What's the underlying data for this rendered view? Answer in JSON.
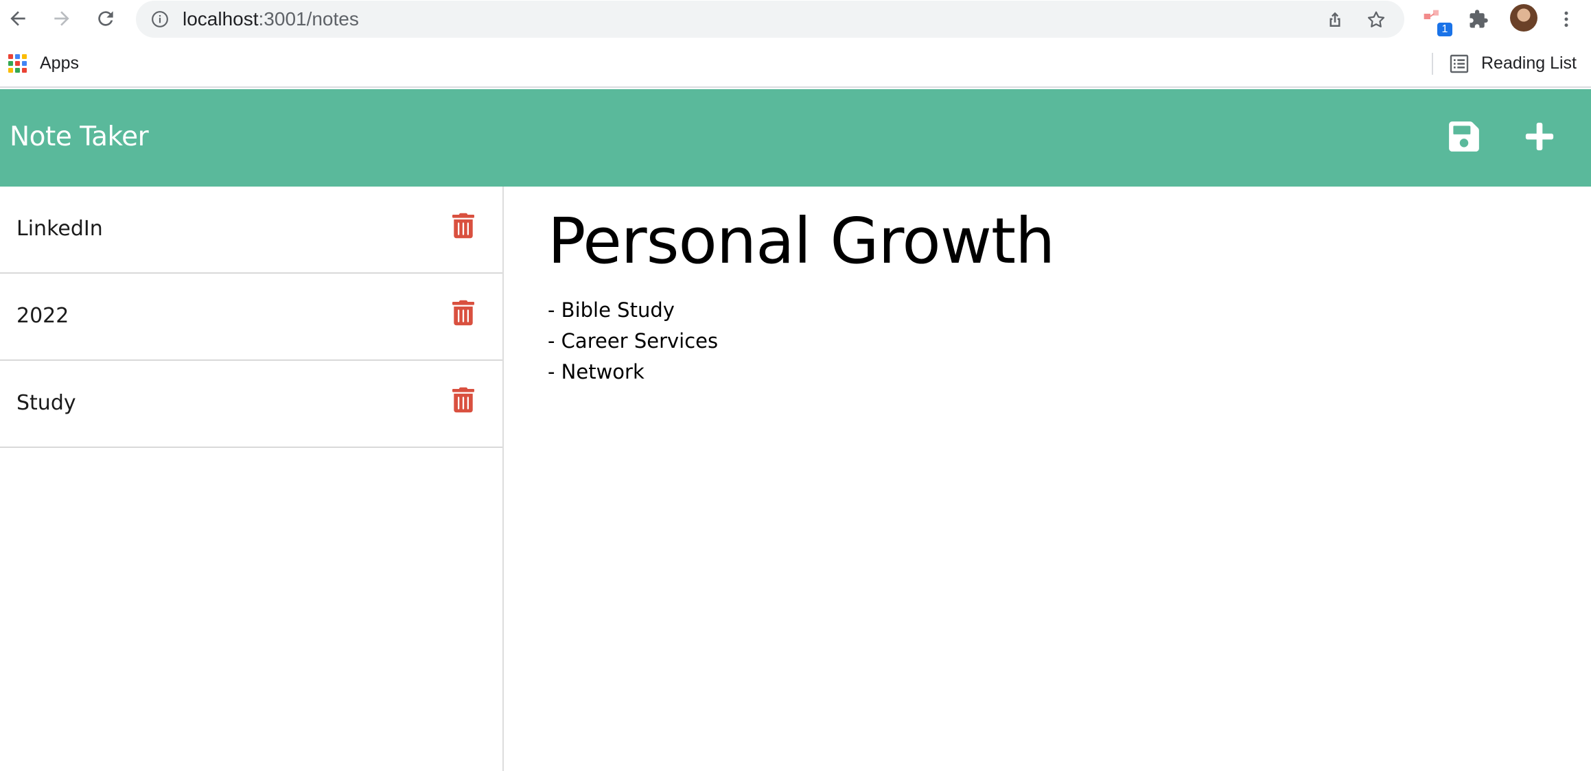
{
  "browser": {
    "url_host": "localhost",
    "url_path": ":3001/notes",
    "extension_badge": "1",
    "bookmarks": {
      "apps_label": "Apps",
      "reading_list_label": "Reading List"
    }
  },
  "app": {
    "title": "Note Taker",
    "accent_color": "#5ab99b",
    "delete_color": "#d9503f",
    "notes": [
      {
        "title": "LinkedIn"
      },
      {
        "title": "2022"
      },
      {
        "title": "Study"
      }
    ],
    "active_note": {
      "title": "Personal Growth",
      "lines": [
        "- Bible Study",
        "- Career Services",
        "- Network"
      ]
    },
    "icons": {
      "save": "save-icon",
      "new": "plus-icon",
      "delete": "trash-icon"
    }
  }
}
